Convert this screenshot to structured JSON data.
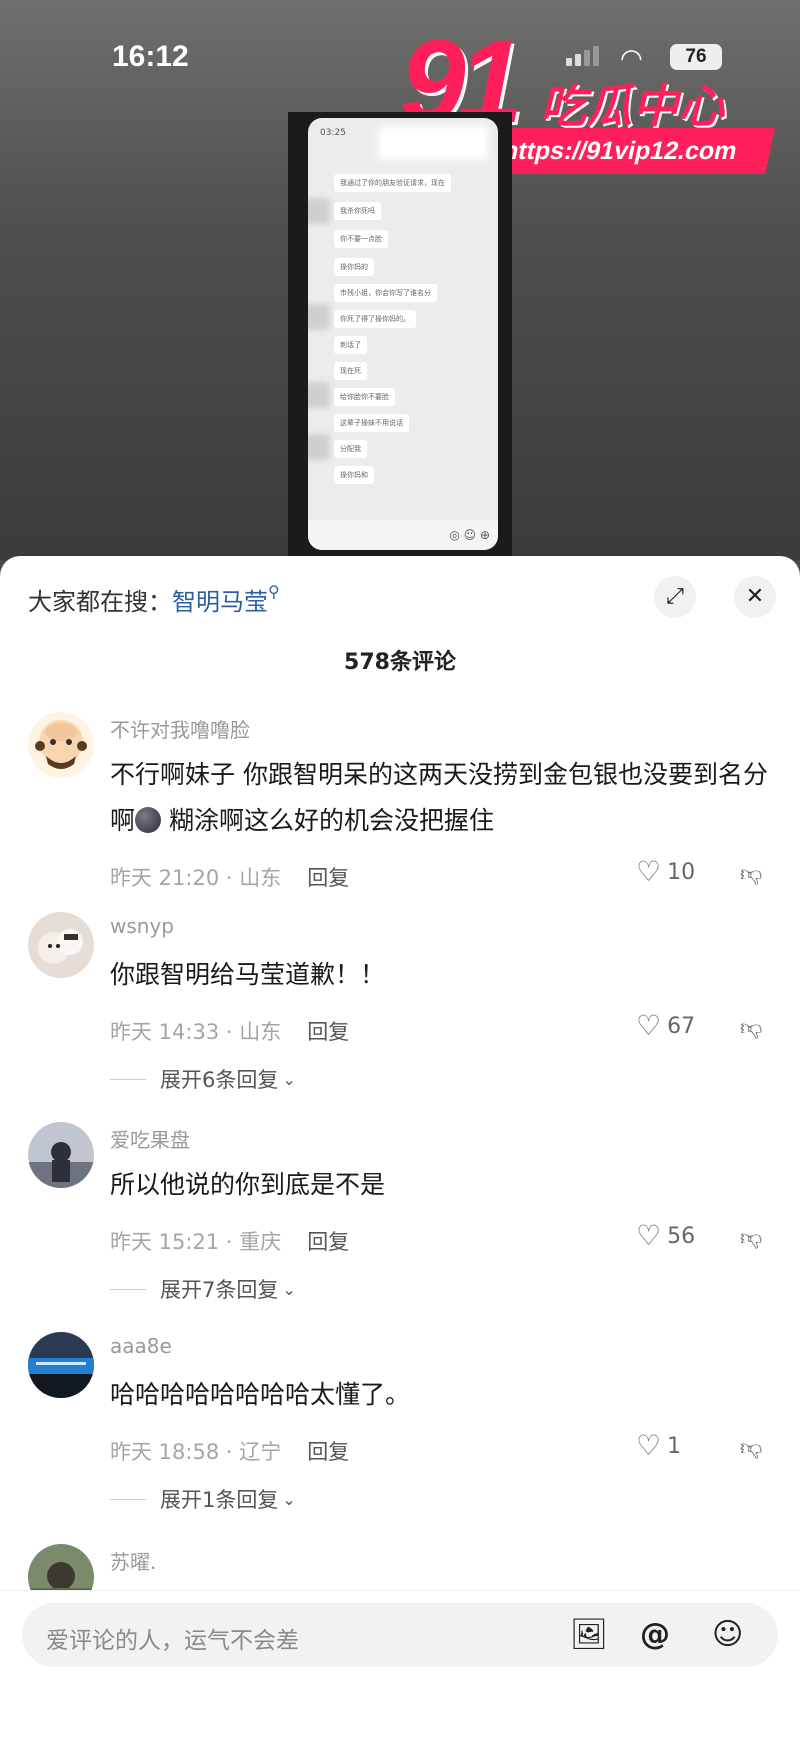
{
  "status": {
    "time": "16:12",
    "battery": "76"
  },
  "watermark": {
    "number": "91",
    "brand": "吃瓜中心",
    "url": "https://91vip12.com"
  },
  "sheet": {
    "search_prefix": "大家都在搜：",
    "search_keyword": "智明马莹",
    "comment_count": "578条评论"
  },
  "comments": [
    {
      "user": "不许对我噜噜脸",
      "text_a": "不行啊妹子 你跟智明呆的这两天没捞到金包银也没要到名分啊",
      "text_b": "糊涂啊这么好的机会没把握住",
      "meta": "昨天 21:20 · 山东",
      "reply": "回复",
      "likes": "10"
    },
    {
      "user": "wsnyp",
      "text": "你跟智明给马莹道歉！！",
      "meta": "昨天 14:33 · 山东",
      "reply": "回复",
      "likes": "67",
      "expand": "展开6条回复"
    },
    {
      "user": "爱吃果盘",
      "text": "所以他说的你到底是不是",
      "meta": "昨天 15:21 · 重庆",
      "reply": "回复",
      "likes": "56",
      "expand": "展开7条回复"
    },
    {
      "user": "aaa8e",
      "text": "哈哈哈哈哈哈哈哈太懂了。",
      "meta": "昨天 18:58 · 辽宁",
      "reply": "回复",
      "likes": "1",
      "expand": "展开1条回复"
    },
    {
      "user": "苏曜."
    }
  ],
  "input": {
    "placeholder": "爱评论的人，运气不会差"
  },
  "icons": [
    "expand-icon",
    "close-icon",
    "heart-icon",
    "dislike-icon",
    "chevron-down-icon",
    "image-icon",
    "at-icon",
    "emoji-icon",
    "search-icon"
  ]
}
